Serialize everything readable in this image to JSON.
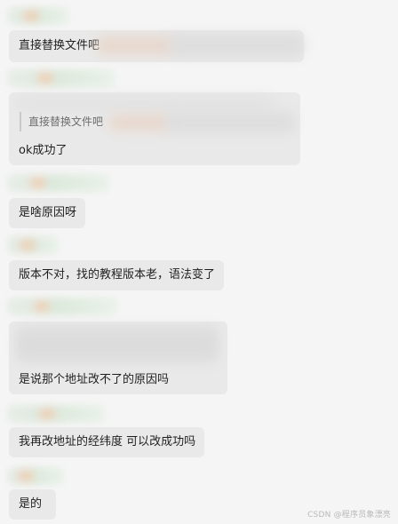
{
  "messages": [
    {
      "text": "直接替换文件吧"
    },
    {
      "quote_text": "直接替换文件吧",
      "text": "ok成功了"
    },
    {
      "text": "是啥原因呀"
    },
    {
      "text": "版本不对，找的教程版本老，语法变了"
    },
    {
      "text": "是说那个地址改不了的原因吗"
    },
    {
      "text": "我再改地址的经纬度 可以改成功吗"
    },
    {
      "text": "是的"
    }
  ],
  "watermark": "CSDN @程序员象漂亮"
}
